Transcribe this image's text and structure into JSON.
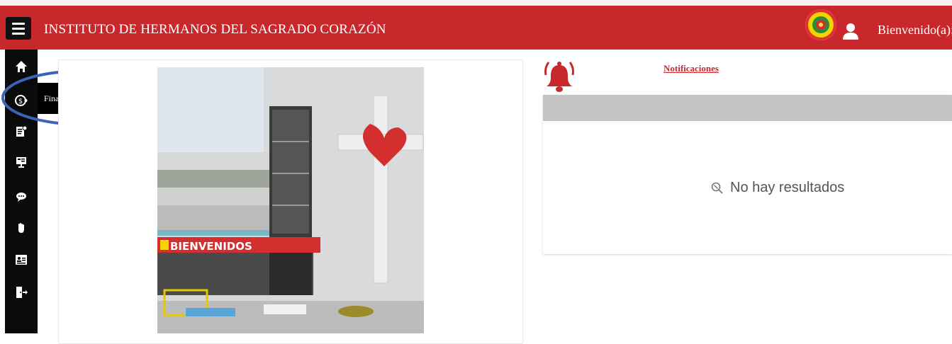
{
  "header": {
    "title": "INSTITUTO DE HERMANOS DEL SAGRADO CORAZÓN",
    "greeting": "Bienvenido(a):",
    "menu_icon": "hamburger-menu-icon",
    "logo_icon": "school-crest-logo",
    "user_icon": "user-icon",
    "color": "#c8282b"
  },
  "sidebar": {
    "items": [
      {
        "icon": "home-icon"
      },
      {
        "icon": "financial-icon",
        "label": "Financiero"
      },
      {
        "icon": "document-icon"
      },
      {
        "icon": "presentation-icon"
      },
      {
        "icon": "chat-icon"
      },
      {
        "icon": "hand-icon"
      },
      {
        "icon": "id-card-icon"
      },
      {
        "icon": "logout-icon"
      }
    ]
  },
  "welcome_image": {
    "sign_text": "BIENVENIDOS"
  },
  "notifications": {
    "link_label": "Notificaciones",
    "empty_text": "No hay resultados",
    "bell_icon": "bell-icon",
    "empty_icon": "search-off-icon"
  }
}
